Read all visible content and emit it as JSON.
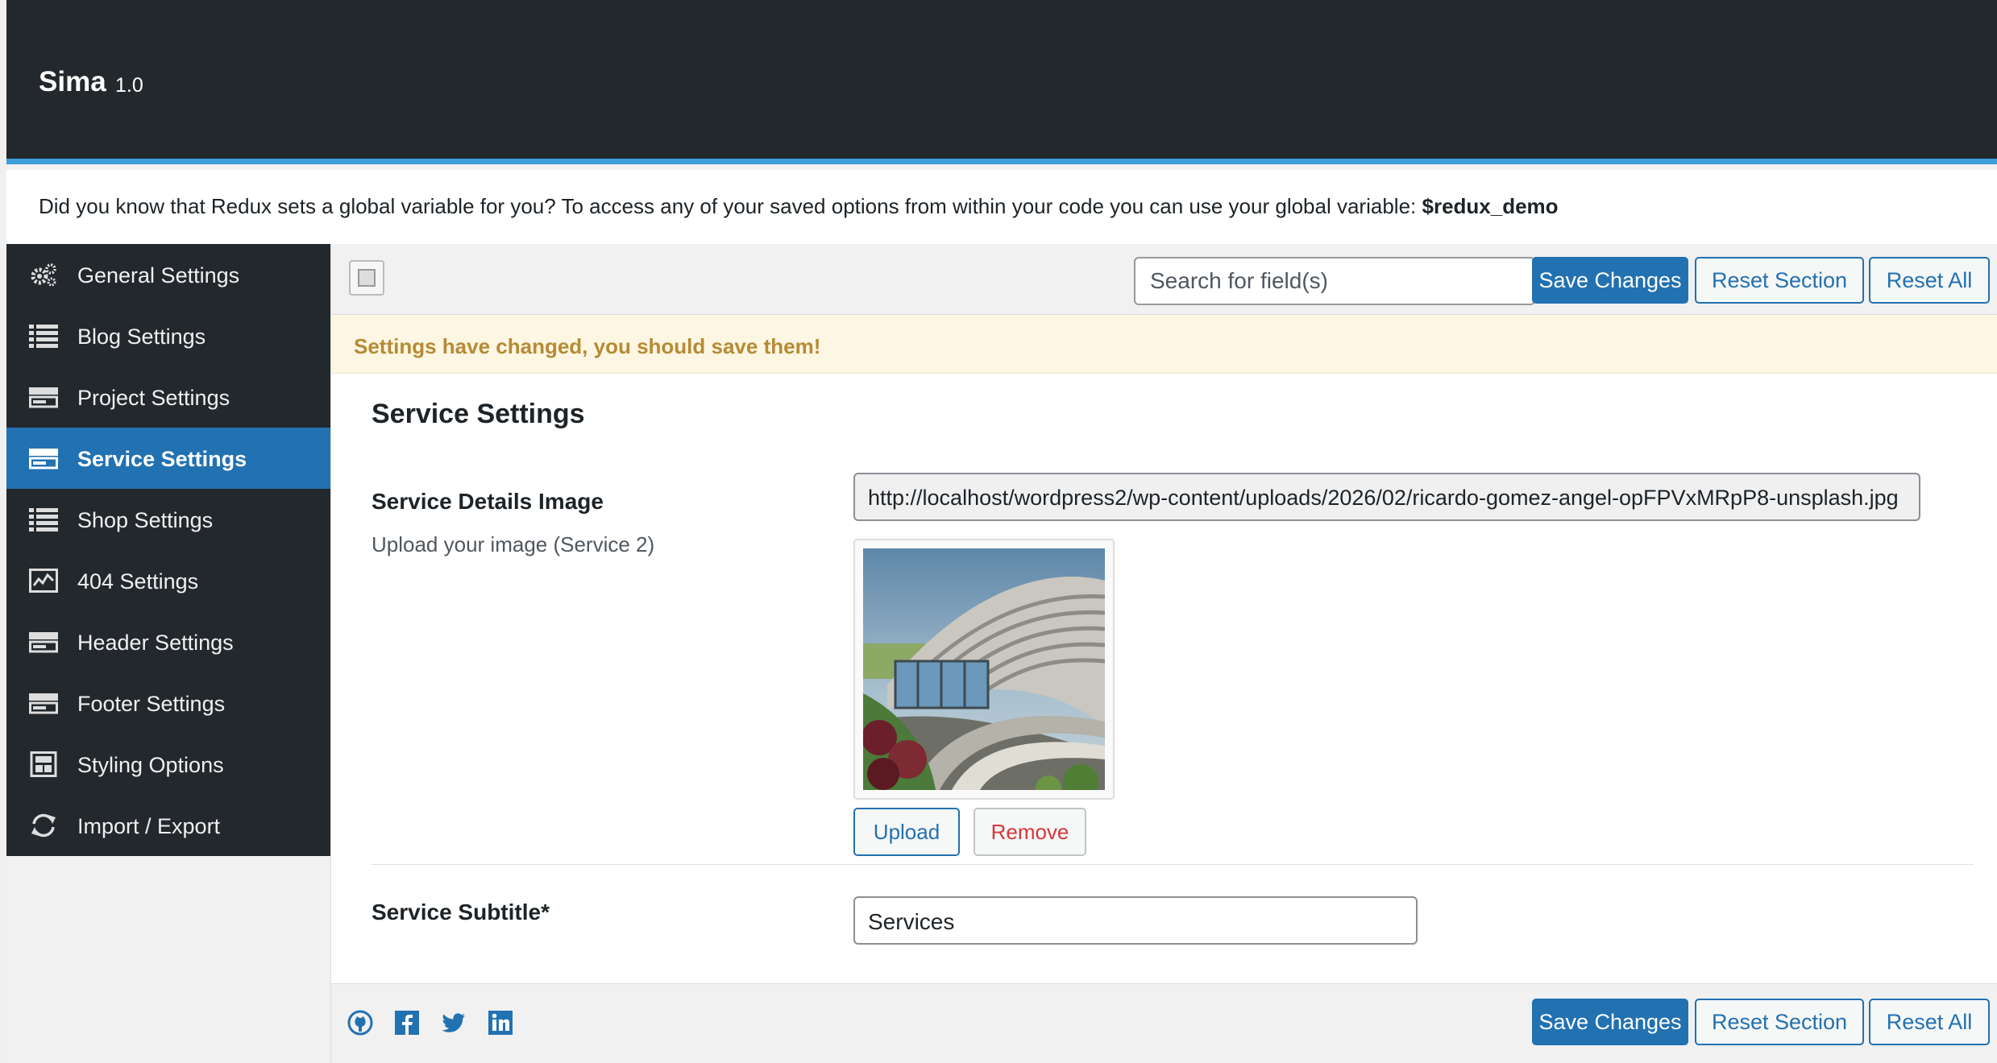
{
  "header": {
    "title": "Sima",
    "version": "1.0"
  },
  "notice": {
    "text": "Did you know that Redux sets a global variable for you? To access any of your saved options from within your code you can use your global variable: ",
    "variable": "$redux_demo"
  },
  "sidebar": {
    "items": [
      {
        "label": "General Settings",
        "icon": "gears-icon"
      },
      {
        "label": "Blog Settings",
        "icon": "list-icon"
      },
      {
        "label": "Project Settings",
        "icon": "card-icon"
      },
      {
        "label": "Service Settings",
        "icon": "card-icon",
        "active": true
      },
      {
        "label": "Shop Settings",
        "icon": "list-icon"
      },
      {
        "label": "404 Settings",
        "icon": "chart-icon"
      },
      {
        "label": "Header Settings",
        "icon": "card-icon"
      },
      {
        "label": "Footer Settings",
        "icon": "card-icon"
      },
      {
        "label": "Styling Options",
        "icon": "layout-icon"
      },
      {
        "label": "Import / Export",
        "icon": "refresh-icon"
      }
    ]
  },
  "toolbar": {
    "search_placeholder": "Search for field(s)",
    "save_label": "Save Changes",
    "reset_section_label": "Reset Section",
    "reset_all_label": "Reset All"
  },
  "warning": "Settings have changed, you should save them!",
  "section": {
    "title": "Service Settings",
    "fields": {
      "image": {
        "label": "Service Details Image",
        "description": "Upload your image (Service 2)",
        "url": "http://localhost/wordpress2/wp-content/uploads/2026/02/ricardo-gomez-angel-opFPVxMRpP8-unsplash.jpg",
        "upload_label": "Upload",
        "remove_label": "Remove"
      },
      "subtitle": {
        "label": "Service Subtitle*",
        "value": "Services"
      }
    }
  },
  "footer": {
    "save_label": "Save Changes",
    "reset_section_label": "Reset Section",
    "reset_all_label": "Reset All",
    "social": [
      "github-icon",
      "facebook-icon",
      "twitter-icon",
      "linkedin-icon"
    ]
  },
  "colors": {
    "header_bg": "#23282d",
    "accent": "#2271b1",
    "header_border": "#3e9fd8",
    "warning_bg": "#fcf6e2",
    "warning_text": "#b78a35",
    "remove_text": "#d63638"
  }
}
